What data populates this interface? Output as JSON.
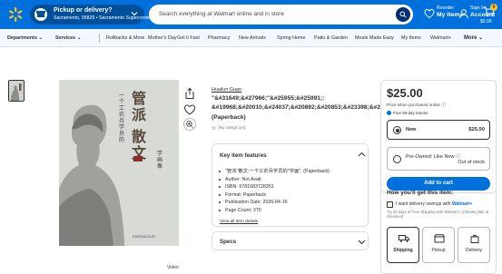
{
  "header": {
    "pickup_title": "Pickup or delivery?",
    "pickup_sub": "Sacramento, 95829 • Sacramento Supercenter",
    "search_placeholder": "Search everything at Walmart online and in store",
    "reorder_l1": "Reorder",
    "reorder_l2": "My Items",
    "signin_l1": "Sign In",
    "signin_l2": "Account",
    "cart_count": "0",
    "cart_price": "$0.00"
  },
  "nav": {
    "departments": "Departments",
    "services": "Services",
    "items": [
      "Rollbacks & More",
      "Mother's Day",
      "Get it Fast",
      "Pharmacy",
      "New Arrivals",
      "Spring Home",
      "Patio & Garden",
      "Meals Made Easy",
      "My Items",
      "Walmart+"
    ],
    "more": "More"
  },
  "product": {
    "author": "Huailun Guan",
    "title_line1": "\"&#31649;&#27966;\"&#25955;&#25991;:",
    "title_line2": "&#19968;&#20010;&#24037;&#20892;&#20853;&#23398;&#21",
    "format": "(Paperback)",
    "ratings": "(No ratings yet)",
    "video_label": "Video",
    "cover": {
      "title_a": "管派",
      "title_b": "散文",
      "subtitle": "一个工农兵学员的",
      "subtitle2": "学画像",
      "publisher": "ENDEAVOUR"
    }
  },
  "key_features": {
    "heading": "Key item features",
    "items": [
      "\"管派\"散文:一个工农兵学员的\"字画\", (Paperback)",
      "Author: Not Avail.",
      "ISBN: 9781683728351",
      "Format: Paperback",
      "Publication Date: 2026-04-16",
      "Page Count: 370"
    ],
    "view_all": "View all item details"
  },
  "specs": {
    "heading": "Specs"
  },
  "buybox": {
    "price": "$25.00",
    "price_note": "Price when purchased online",
    "free_returns": "Free 90-day returns",
    "new_label": "New",
    "new_price": "$25.00",
    "used_label": "Pre-Owned: Like New",
    "used_status": "Out of stock",
    "add_to_cart": "Add to cart"
  },
  "fulfillment": {
    "title": "How you'll get this item:",
    "check_label": "I want delivery savings with",
    "walmart_plus": "Walmart+",
    "note": "Try 30 days of Free Shipping with Walmart+ (Choose plan at checkout)",
    "options": [
      "Shipping",
      "Pickup",
      "Delivery"
    ]
  },
  "colors": {
    "walmart_blue": "#0071dc",
    "dark_blue": "#002e6e",
    "spark_yellow": "#ffc220",
    "text": "#2e2f32"
  }
}
